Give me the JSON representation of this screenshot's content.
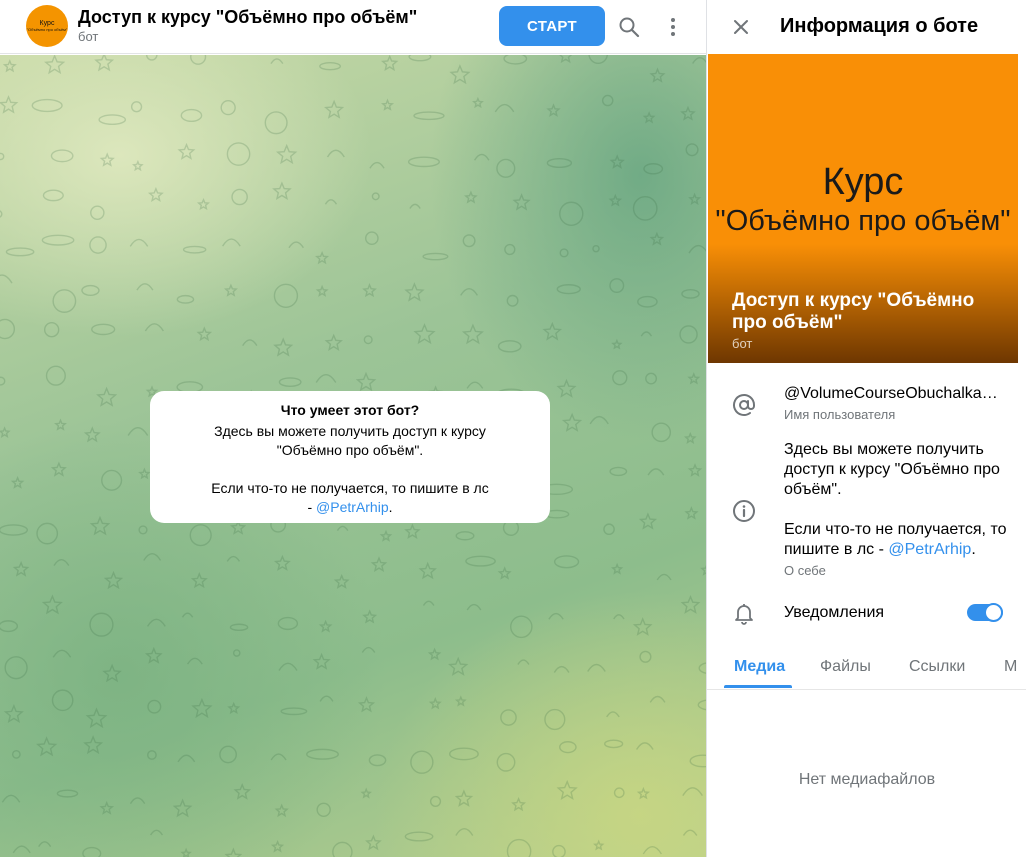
{
  "chat": {
    "avatar_line1": "Курс",
    "avatar_line2": "\"Объёмно про объём\"",
    "title": "Доступ к курсу \"Объёмно про объём\"",
    "subtitle": "бот",
    "start_label": "СТАРТ",
    "icons": [
      "search-icon",
      "more-vertical-icon"
    ]
  },
  "card": {
    "title": "Что умеет этот бот?",
    "line1": "Здесь вы можете получить доступ к курсу",
    "line2": "\"Объёмно про объём\".",
    "line3": "Если что-то не получается, то пишите в лс",
    "line4_prefix": "- ",
    "link": "@PetrArhip",
    "line4_suffix": "."
  },
  "panel": {
    "title": "Информация о боте",
    "close_icon": "close-icon",
    "hero": {
      "line1": "Курс",
      "line2": "\"Объёмно про объём\"",
      "name": "Доступ к курсу \"Объёмно про объём\"",
      "subtitle": "бот"
    },
    "username": "@VolumeCourseObuchalka_…",
    "username_caption": "Имя пользователя",
    "about_line1": "Здесь вы можете получить доступ к курсу \"Объёмно про объём\".",
    "about_line2_prefix": "Если что-то не получается, то пишите в лс - ",
    "about_link": "@PetrArhip",
    "about_line2_suffix": ".",
    "about_caption": "О себе",
    "notifications_label": "Уведомления",
    "notifications_on": true,
    "tabs": [
      {
        "label": "Медиа",
        "active": true
      },
      {
        "label": "Файлы",
        "active": false
      },
      {
        "label": "Ссылки",
        "active": false
      },
      {
        "label": "М",
        "active": false
      }
    ],
    "empty_label": "Нет медиафайлов"
  },
  "colors": {
    "accent": "#3390ec",
    "hero_bg": "#f98f06",
    "avatar_bg": "#f49400",
    "secondary_text": "#707579"
  }
}
